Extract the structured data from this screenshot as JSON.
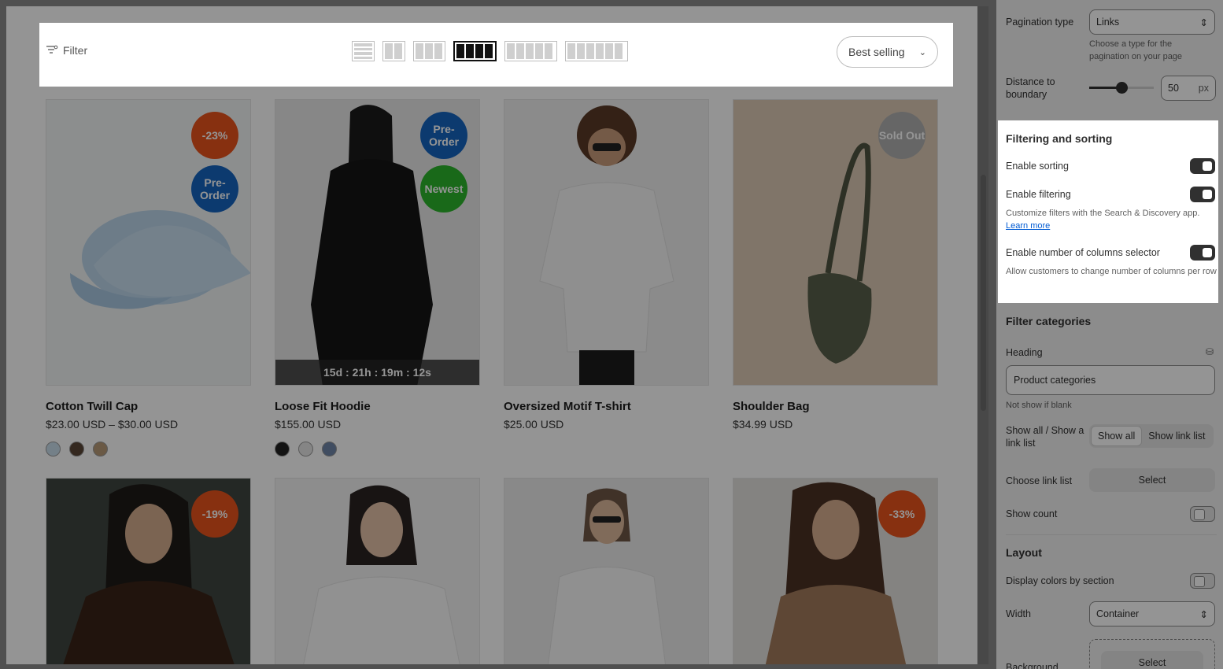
{
  "toolbar": {
    "filter_label": "Filter",
    "column_options": [
      {
        "type": "list",
        "count": 4
      },
      {
        "type": "cols",
        "count": 2
      },
      {
        "type": "cols",
        "count": 3
      },
      {
        "type": "cols",
        "count": 4,
        "active": true
      },
      {
        "type": "cols",
        "count": 5
      },
      {
        "type": "cols",
        "count": 6
      }
    ],
    "sort_label": "Best selling"
  },
  "products": [
    {
      "title": "Cotton Twill Cap",
      "price": "$23.00 USD – $30.00 USD",
      "badges": [
        "-23%",
        "Pre-Order"
      ],
      "swatches": [
        "#c8dceb",
        "#5a4636",
        "#b79a78"
      ]
    },
    {
      "title": "Loose Fit Hoodie",
      "price": "$155.00 USD",
      "badges": [
        "Pre-Order",
        "Newest"
      ],
      "countdown": "15d : 21h : 19m : 12s",
      "swatches": [
        "#222222",
        "#e6e6e6",
        "#6f86a8"
      ]
    },
    {
      "title": "Oversized Motif T-shirt",
      "price": "$25.00 USD",
      "badges": [],
      "swatches": []
    },
    {
      "title": "Shoulder Bag",
      "price": "$34.99 USD",
      "badges": [
        "Sold Out"
      ],
      "swatches": []
    },
    {
      "badges": [
        "-19%"
      ]
    },
    {
      "badges": []
    },
    {
      "badges": []
    },
    {
      "badges": [
        "-33%"
      ]
    }
  ],
  "settings": {
    "pagination_type_label": "Pagination type",
    "pagination_type_value": "Links",
    "pagination_help": "Choose a type for the pagination on your page",
    "distance_label": "Distance to boundary",
    "distance_value": "50",
    "distance_unit": "px",
    "distance_level": 0.5,
    "filtering_heading": "Filtering and sorting",
    "enable_sorting": "Enable sorting",
    "enable_filtering": "Enable filtering",
    "filtering_help": "Customize filters with the Search & Discovery app.",
    "learn_more": "Learn more",
    "enable_columns": "Enable number of columns selector",
    "columns_help": "Allow customers to change number of columns per row",
    "filter_categories_heading": "Filter categories",
    "heading_label": "Heading",
    "heading_value": "Product categories",
    "heading_help": "Not show if blank",
    "show_all_label": "Show all / Show a link list",
    "show_all_option": "Show all",
    "show_link_option": "Show link list",
    "choose_link_label": "Choose link list",
    "select_label": "Select",
    "show_count_label": "Show count",
    "layout_heading": "Layout",
    "display_colors_label": "Display colors by section",
    "width_label": "Width",
    "width_value": "Container",
    "background_label": "Background",
    "bg_select_label": "Select"
  }
}
